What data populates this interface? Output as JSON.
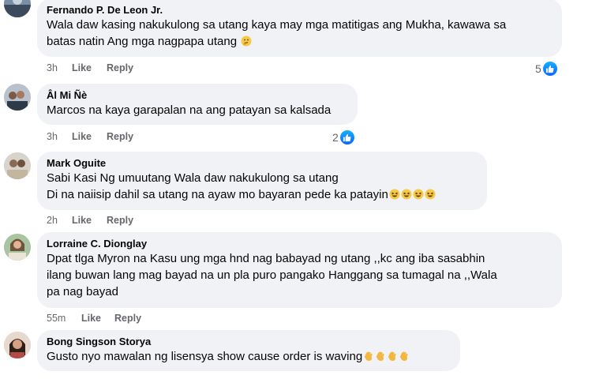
{
  "comments": [
    {
      "author": "Fernando P. De Leon Jr.",
      "lines": [
        "Wala daw kasing nakukulong sa utang kaya may mga matitigas ang Mukha, kawawa sa",
        "batas natin Ang mga nagpapa utang"
      ],
      "time": "3h",
      "like": "Like",
      "reply": "Reply",
      "reaction_count": "5"
    },
    {
      "author": "Âl Mi Ñè",
      "lines": [
        "Marcos na kaya garapalan na ang patayan sa kalsada"
      ],
      "time": "3h",
      "like": "Like",
      "reply": "Reply",
      "reaction_count": "2"
    },
    {
      "author": "Mark Oguite",
      "lines": [
        "Sabi Kasi Ng umuutang Wala daw nakukulong sa utang",
        "Di na naiisip dahil sa utang na ayaw mo bayaran pede ka patayin"
      ],
      "time": "2h",
      "like": "Like",
      "reply": "Reply"
    },
    {
      "author": "Lorraine C. Dionglay",
      "lines": [
        "Dpat tlga Myron na Kasu ung mga hnd nag babayad ng utang ,,kc ang iba sasabhin",
        "ilang buwan lang mag bayad na un pla puro pangako Hanggang sa tumagal na ,,Wala",
        "pa nag bayad"
      ],
      "time": "55m",
      "like": "Like",
      "reply": "Reply"
    },
    {
      "author": "Bong Singson Storya",
      "lines": [
        "Gusto nyo mawalan ng lisensya show cause order is waving"
      ],
      "time": "",
      "like": "",
      "reply": ""
    }
  ],
  "icons": {
    "thinking": "thinking-face-emoji",
    "grin": "grinning-squinting-face-emoji",
    "wave": "waving-hand-emoji",
    "like_badge": "like-thumb-icon"
  },
  "colors": {
    "bubble": "#f0f2f5",
    "meta": "#65676b",
    "like_blue": "#0866ff"
  }
}
